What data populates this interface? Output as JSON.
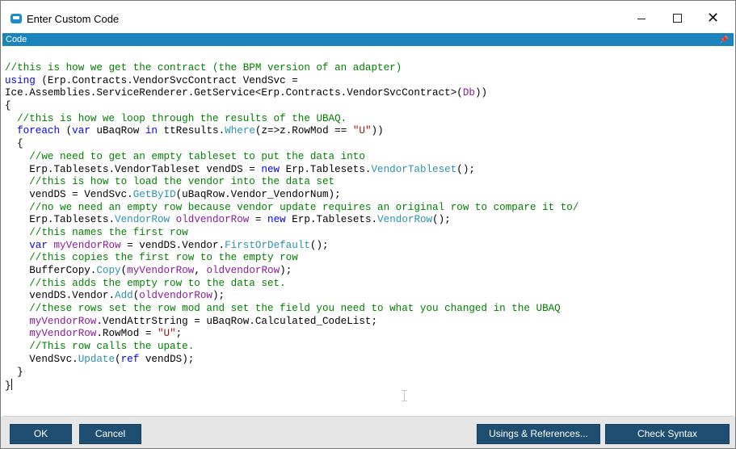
{
  "window": {
    "title": "Enter Custom Code"
  },
  "panel": {
    "header": "Code"
  },
  "code_lines": [
    [
      [
        "comment",
        "//this is how we get the contract (the BPM version of an adapter)"
      ]
    ],
    [
      [
        "keyword",
        "using"
      ],
      [
        "plain",
        " (Erp.Contracts.VendorSvcContract VendSvc ="
      ]
    ],
    [
      [
        "plain",
        "Ice.Assemblies.ServiceRenderer.GetService<Erp.Contracts.VendorSvcContract>("
      ],
      [
        "variable",
        "Db"
      ],
      [
        "plain",
        "))"
      ]
    ],
    [
      [
        "plain",
        "{"
      ]
    ],
    [
      [
        "plain",
        "  "
      ],
      [
        "comment",
        "//this is how we loop through the results of the UBAQ."
      ]
    ],
    [
      [
        "plain",
        "  "
      ],
      [
        "keyword",
        "foreach"
      ],
      [
        "plain",
        " ("
      ],
      [
        "keyword",
        "var"
      ],
      [
        "plain",
        " uBaqRow "
      ],
      [
        "keyword",
        "in"
      ],
      [
        "plain",
        " ttResults."
      ],
      [
        "member",
        "Where"
      ],
      [
        "plain",
        "(z=>z.RowMod == "
      ],
      [
        "string",
        "\"U\""
      ],
      [
        "plain",
        "))"
      ]
    ],
    [
      [
        "plain",
        "  {"
      ]
    ],
    [
      [
        "plain",
        "    "
      ],
      [
        "comment",
        "//we need to get an empty tableset to put the data into"
      ]
    ],
    [
      [
        "plain",
        "    Erp.Tablesets.VendorTableset vendDS = "
      ],
      [
        "keyword",
        "new"
      ],
      [
        "plain",
        " Erp.Tablesets."
      ],
      [
        "type",
        "VendorTableset"
      ],
      [
        "plain",
        "();"
      ]
    ],
    [
      [
        "plain",
        "    "
      ],
      [
        "comment",
        "//this is how to load the vendor into the data set"
      ]
    ],
    [
      [
        "plain",
        "    vendDS = VendSvc."
      ],
      [
        "member",
        "GetByID"
      ],
      [
        "plain",
        "(uBaqRow.Vendor_VendorNum);"
      ]
    ],
    [
      [
        "plain",
        "    "
      ],
      [
        "comment",
        "//no we need an empty row because vendor update requires an original row to compare it to/"
      ]
    ],
    [
      [
        "plain",
        "    Erp.Tablesets."
      ],
      [
        "type",
        "VendorRow"
      ],
      [
        "plain",
        " "
      ],
      [
        "variable",
        "oldvendorRow"
      ],
      [
        "plain",
        " = "
      ],
      [
        "keyword",
        "new"
      ],
      [
        "plain",
        " Erp.Tablesets."
      ],
      [
        "type",
        "VendorRow"
      ],
      [
        "plain",
        "();"
      ]
    ],
    [
      [
        "plain",
        "    "
      ],
      [
        "comment",
        "//this names the first row"
      ]
    ],
    [
      [
        "plain",
        "    "
      ],
      [
        "keyword",
        "var"
      ],
      [
        "plain",
        " "
      ],
      [
        "variable",
        "myVendorRow"
      ],
      [
        "plain",
        " = vendDS.Vendor."
      ],
      [
        "member",
        "FirstOrDefault"
      ],
      [
        "plain",
        "();"
      ]
    ],
    [
      [
        "plain",
        "    "
      ],
      [
        "comment",
        "//this copies the first row to the empty row"
      ]
    ],
    [
      [
        "plain",
        "    BufferCopy."
      ],
      [
        "member",
        "Copy"
      ],
      [
        "plain",
        "("
      ],
      [
        "variable",
        "myVendorRow"
      ],
      [
        "plain",
        ", "
      ],
      [
        "variable",
        "oldvendorRow"
      ],
      [
        "plain",
        ");"
      ]
    ],
    [
      [
        "plain",
        "    "
      ],
      [
        "comment",
        "//this adds the empty row to the data set."
      ]
    ],
    [
      [
        "plain",
        "    vendDS.Vendor."
      ],
      [
        "member",
        "Add"
      ],
      [
        "plain",
        "("
      ],
      [
        "variable",
        "oldvendorRow"
      ],
      [
        "plain",
        ");"
      ]
    ],
    [
      [
        "plain",
        "    "
      ],
      [
        "comment",
        "//these rows set the row mod and set the field you need to what you changed in the UBAQ"
      ]
    ],
    [
      [
        "plain",
        "    "
      ],
      [
        "variable",
        "myVendorRow"
      ],
      [
        "plain",
        ".VendAttrString = uBaqRow.Calculated_CodeList;"
      ]
    ],
    [
      [
        "plain",
        "    "
      ],
      [
        "variable",
        "myVendorRow"
      ],
      [
        "plain",
        ".RowMod = "
      ],
      [
        "string",
        "\"U\""
      ],
      [
        "plain",
        ";"
      ]
    ],
    [
      [
        "plain",
        "    "
      ],
      [
        "comment",
        "//This row calls the upate."
      ]
    ],
    [
      [
        "plain",
        "    VendSvc."
      ],
      [
        "member",
        "Update"
      ],
      [
        "plain",
        "("
      ],
      [
        "keyword",
        "ref"
      ],
      [
        "plain",
        " vendDS);"
      ]
    ],
    [
      [
        "plain",
        "  }"
      ]
    ],
    [
      [
        "plain",
        "}"
      ]
    ]
  ],
  "buttons": {
    "ok": "OK",
    "cancel": "Cancel",
    "usings": "Usings & References...",
    "check_syntax": "Check Syntax"
  },
  "colors": {
    "header_bar": "#1a84bd",
    "button_bg": "#1e4f73",
    "comment": "#008000",
    "keyword": "#0000ff",
    "type": "#2b91af",
    "variable": "#8a1a9a",
    "string": "#a31515"
  },
  "icons": {
    "app": "app-window-icon",
    "minimize": "minimize-icon",
    "maximize": "maximize-icon",
    "close": "close-icon",
    "pin": "pin-icon"
  }
}
